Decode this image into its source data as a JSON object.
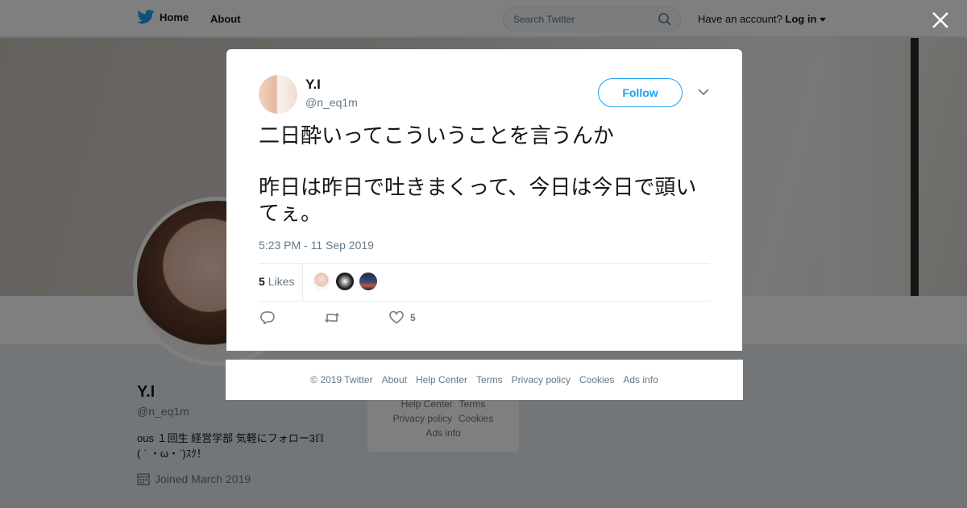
{
  "nav": {
    "home_label": "Home",
    "about_label": "About",
    "search_placeholder": "Search Twitter",
    "account_prompt": "Have an account?",
    "login_label": "Log in"
  },
  "profile": {
    "name": "Y.I",
    "handle": "@n_eq1m",
    "bio_line1": "ous １回生 経営学部 気軽にフォロー3ℿ",
    "bio_line2": "( ˋ ・ω・ˊ)ｽｸ！",
    "joined": "Joined March 2019"
  },
  "side_links": [
    "Help Center",
    "Terms",
    "Privacy policy",
    "Cookies",
    "Ads info"
  ],
  "tweet": {
    "author_name": "Y.I",
    "author_handle": "@n_eq1m",
    "follow_label": "Follow",
    "text": "二日酔いってこういうことを言うんか\n\n昨日は昨日で吐きまくって、今日は今日で頭いてぇ。",
    "timestamp": "5:23 PM - 11 Sep 2019",
    "likes_count": "5",
    "likes_label": "Likes",
    "action_like_count": "5"
  },
  "footer": {
    "copyright": "© 2019 Twitter",
    "links": [
      "About",
      "Help Center",
      "Terms",
      "Privacy policy",
      "Cookies",
      "Ads info"
    ]
  },
  "colors": {
    "accent": "#1da1f2",
    "muted_text": "#657786",
    "overlay": "rgba(0,0,0,0.5)"
  },
  "icons": [
    "twitter-bird-icon",
    "home-icon",
    "search-icon",
    "caret-down-icon",
    "close-icon",
    "calendar-icon",
    "chevron-down-icon",
    "reply-icon",
    "retweet-icon",
    "heart-icon"
  ]
}
